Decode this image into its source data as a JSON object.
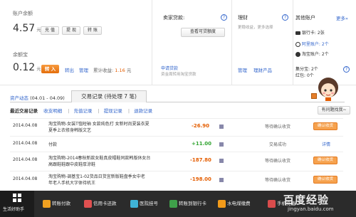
{
  "colors": {
    "accent": "#e45d00",
    "link": "#3366cc",
    "income": "#33a533",
    "taskbar": "#2b2b2b"
  },
  "balance": {
    "label": "账户余额",
    "amount": "4.57",
    "unit": "元",
    "buttons": [
      "充 值",
      "提 现",
      "转 账"
    ]
  },
  "yuebao": {
    "label": "余额宝",
    "amount": "0.12",
    "unit": "元",
    "transfer_in": "转 入",
    "links": [
      "转出",
      "管理"
    ],
    "earnings_label": "累计收益:",
    "earnings_value": "1.16",
    "earnings_unit": "元"
  },
  "credit": {
    "title": "卖家贷款:",
    "help": "?",
    "view_button": "查看可贷额度",
    "apply_link": "申请贷款",
    "note": "资金周转用淘宝贷款"
  },
  "licai": {
    "title": "理财",
    "help": "?",
    "line1": "更稳收益，更多选择",
    "manage": "管理",
    "products": "理财产品"
  },
  "other": {
    "title": "其他账户",
    "more": "更多»",
    "items": [
      {
        "icon": "bank-card-icon",
        "name": "银行卡:",
        "count": "2张"
      },
      {
        "icon": "alibaba-icon",
        "name": "阿里账户:",
        "count": "2个"
      },
      {
        "icon": "taobao-icon",
        "name": "淘宝账户:",
        "count": "2个"
      }
    ],
    "points_label": "集分宝:",
    "points_value": "2个",
    "redpack_label": "红包:",
    "redpack_value": "0个"
  },
  "period": {
    "label": "资产动态",
    "range": "(04.01 - 04.09)"
  },
  "trade_tab": "交易记录 (待处理 7 笔)",
  "subtabs": [
    "最近交易记录",
    "收支明细",
    "充值记录",
    "提现记录",
    "退款记录"
  ],
  "help_button": "有问题找我~",
  "rows": [
    {
      "date": "2014.04.08",
      "desc": [
        "淘宝购物-女装T恤短袖 女款纯色打 女新时尚夏装衣夏",
        "夏季上衣修身韩版文艺"
      ],
      "amount": "-26.90",
      "amount_type": "out",
      "status": "等待确认收货",
      "action": "确认收货",
      "action_type": "button"
    },
    {
      "date": "2014.04.08",
      "desc": [
        "付款"
      ],
      "amount": "+11.00",
      "amount_type": "in",
      "status": "交易成功",
      "action": "详情",
      "action_type": "link"
    },
    {
      "date": "2014.04.08",
      "desc": [
        "淘宝购物-2014春秋新款女鞋真皮帽鞋同款韩版休女台",
        "高跟鞋鞋跟中皮鞋厚涼鞋"
      ],
      "amount": "-187.80",
      "amount_type": "out",
      "status": "等待确认收货",
      "action": "确认收货",
      "action_type": "button"
    },
    {
      "date": "2014.04.08",
      "desc": [
        "淘宝购物-调基宝1-02货品日货宜新版鞋盘季女中老",
        "年老人手机大字体待机王"
      ],
      "amount": "-198.00",
      "amount_type": "out",
      "status": "等待确认收货",
      "action": "确认收货",
      "action_type": "button"
    }
  ],
  "taskbar": {
    "items": [
      "生活好助手",
      "转账付款",
      "信用卡还款",
      "医院挂号",
      "转账到银行卡",
      "水电煤缴费",
      "手机充值"
    ],
    "icon_names": [
      "grid-icon",
      "transfer-icon",
      "credit-card-icon",
      "hospital-icon",
      "bank-transfer-icon",
      "utility-icon",
      "phone-icon"
    ],
    "icon_colors": [
      "#ffffff",
      "#f0a020",
      "#e05050",
      "#3fb3d6",
      "#3fa04a",
      "#f39b1a",
      "#d94c4c"
    ]
  },
  "watermark": {
    "brand": "百度经验",
    "url": "jingyan.baidu.com"
  }
}
